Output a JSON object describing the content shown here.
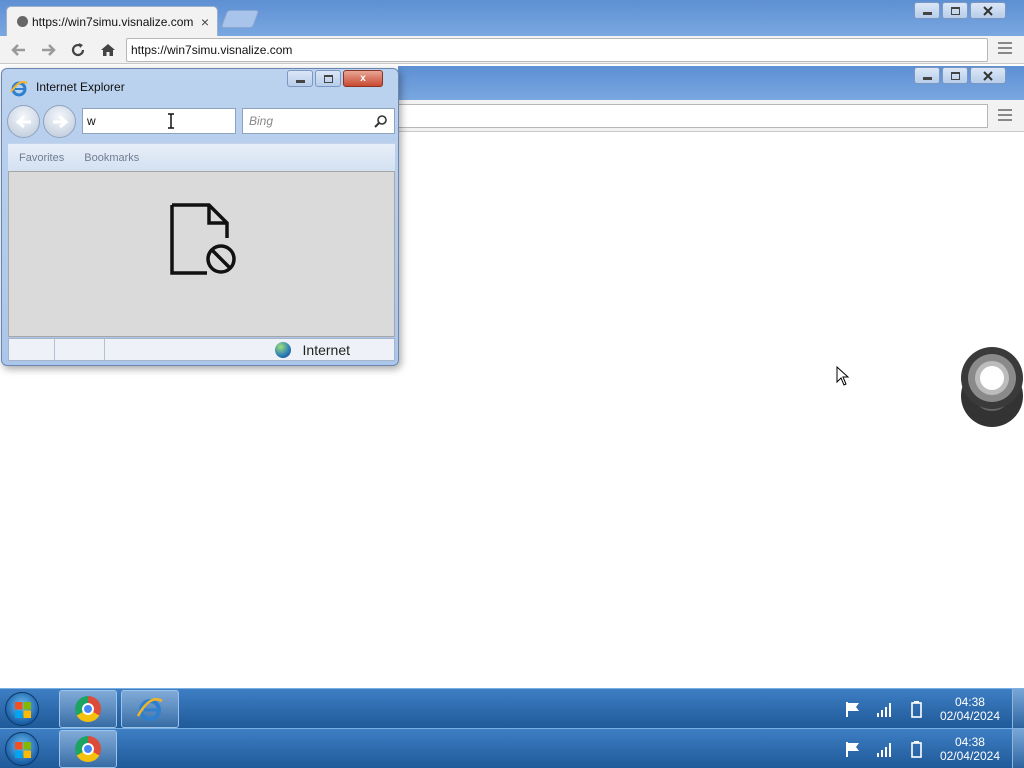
{
  "chrome": {
    "tab_title": "https://win7simu.visnalize.com",
    "tab_close": "×",
    "url": "https://win7simu.visnalize.com"
  },
  "ie": {
    "window_title": "Internet Explorer",
    "address_value": "w",
    "search_placeholder": "Bing",
    "favorites_label": "Favorites",
    "bookmarks_label": "Bookmarks",
    "status_zone": "Internet",
    "close_glyph": "x"
  },
  "taskbar_top": {
    "time": "04:38",
    "date": "02/04/2024"
  },
  "taskbar_bottom": {
    "time": "04:38",
    "date": "02/04/2024"
  },
  "colors": {
    "titlebar": "#5d8fd3",
    "taskbar": "#2b69ad",
    "close_button": "#c94a31"
  }
}
